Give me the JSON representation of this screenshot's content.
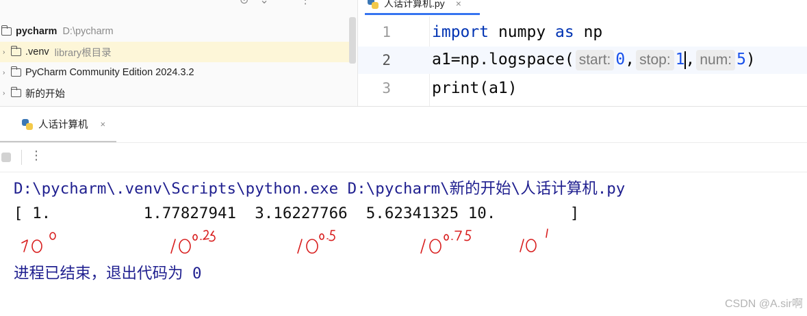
{
  "project_tree": {
    "root": {
      "name": "pycharm",
      "path": "D:\\pycharm"
    },
    "items": [
      {
        "name": ".venv",
        "hint": "library根目录"
      },
      {
        "name": "PyCharm Community Edition 2024.3.2",
        "hint": ""
      },
      {
        "name": "新的开始",
        "hint": ""
      }
    ]
  },
  "editor": {
    "tab_label": "人话计算机.py",
    "tab_close": "×",
    "lines": [
      {
        "number": "1"
      },
      {
        "number": "2"
      },
      {
        "number": "3"
      }
    ],
    "code": {
      "l1_kw1": "import",
      "l1_mod": " numpy ",
      "l1_kw2": "as",
      "l1_alias": " np",
      "l2_call": "a1=np.logspace(",
      "l2_hint_start": "start:",
      "l2_val_start": "0",
      "l2_hint_stop": "stop:",
      "l2_val_stop": "1",
      "l2_hint_num": "num:",
      "l2_val_num": "5",
      "l2_close": ")",
      "l3_code": "print(a1)",
      "comma": ","
    }
  },
  "run_window": {
    "tab_label": "人话计算机",
    "tab_close": "×",
    "more_icon": "⋮",
    "console_lines": [
      "D:\\pycharm\\.venv\\Scripts\\python.exe D:\\pycharm\\新的开始\\人话计算机.py",
      "[ 1.          1.77827941  3.16227766  5.62341325 10.        ]",
      "进程已结束，退出代码为 0"
    ]
  },
  "annotation_color": "#d81e1e",
  "watermark": "CSDN @A.sir啊"
}
